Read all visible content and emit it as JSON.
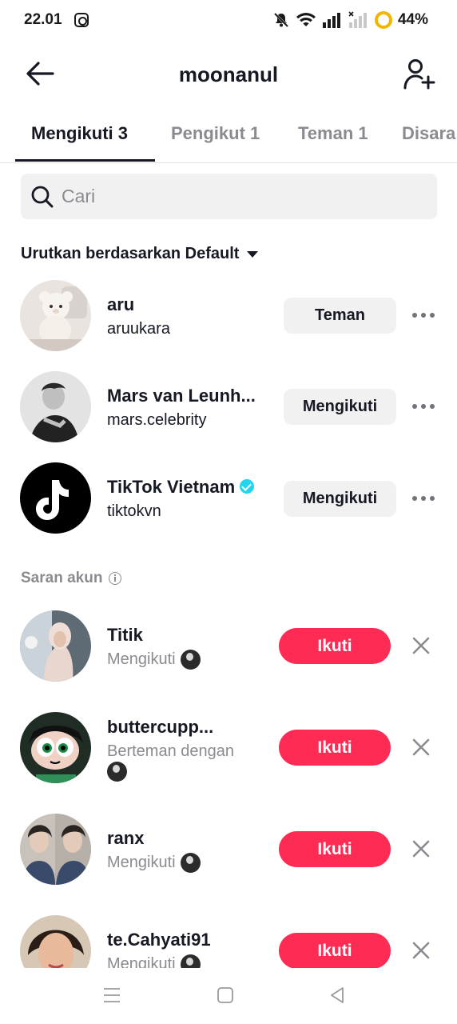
{
  "status_bar": {
    "time": "22.01",
    "battery": "44%"
  },
  "header": {
    "title": "moonanul"
  },
  "tabs": [
    {
      "label": "Mengikuti 3"
    },
    {
      "label": "Pengikut 1"
    },
    {
      "label": "Teman 1"
    },
    {
      "label": "Disara"
    }
  ],
  "search": {
    "placeholder": "Cari",
    "value": ""
  },
  "sort": {
    "label": "Urutkan berdasarkan Default"
  },
  "following": [
    {
      "name": "aru",
      "handle": "aruukara",
      "button": "Teman"
    },
    {
      "name": "Mars van Leunh...",
      "handle": "mars.celebrity",
      "button": "Mengikuti"
    },
    {
      "name": "TikTok Vietnam",
      "handle": "tiktokvn",
      "button": "Mengikuti",
      "verified": true
    }
  ],
  "suggestions": {
    "title": "Saran akun",
    "items": [
      {
        "name": "Titik",
        "subtitle": "Mengikuti",
        "button": "Ikuti"
      },
      {
        "name": "buttercupp...",
        "subtitle": "Berteman dengan",
        "button": "Ikuti"
      },
      {
        "name": "ranx",
        "subtitle": "Mengikuti",
        "button": "Ikuti"
      },
      {
        "name": "te.Cahyati91",
        "subtitle": "Mengikuti",
        "button": "Ikuti"
      }
    ]
  },
  "colors": {
    "accent": "#fe2c55",
    "verified": "#20d5ec",
    "text": "#161823",
    "muted": "#8a8b91",
    "chip_bg": "#f1f1f2"
  }
}
